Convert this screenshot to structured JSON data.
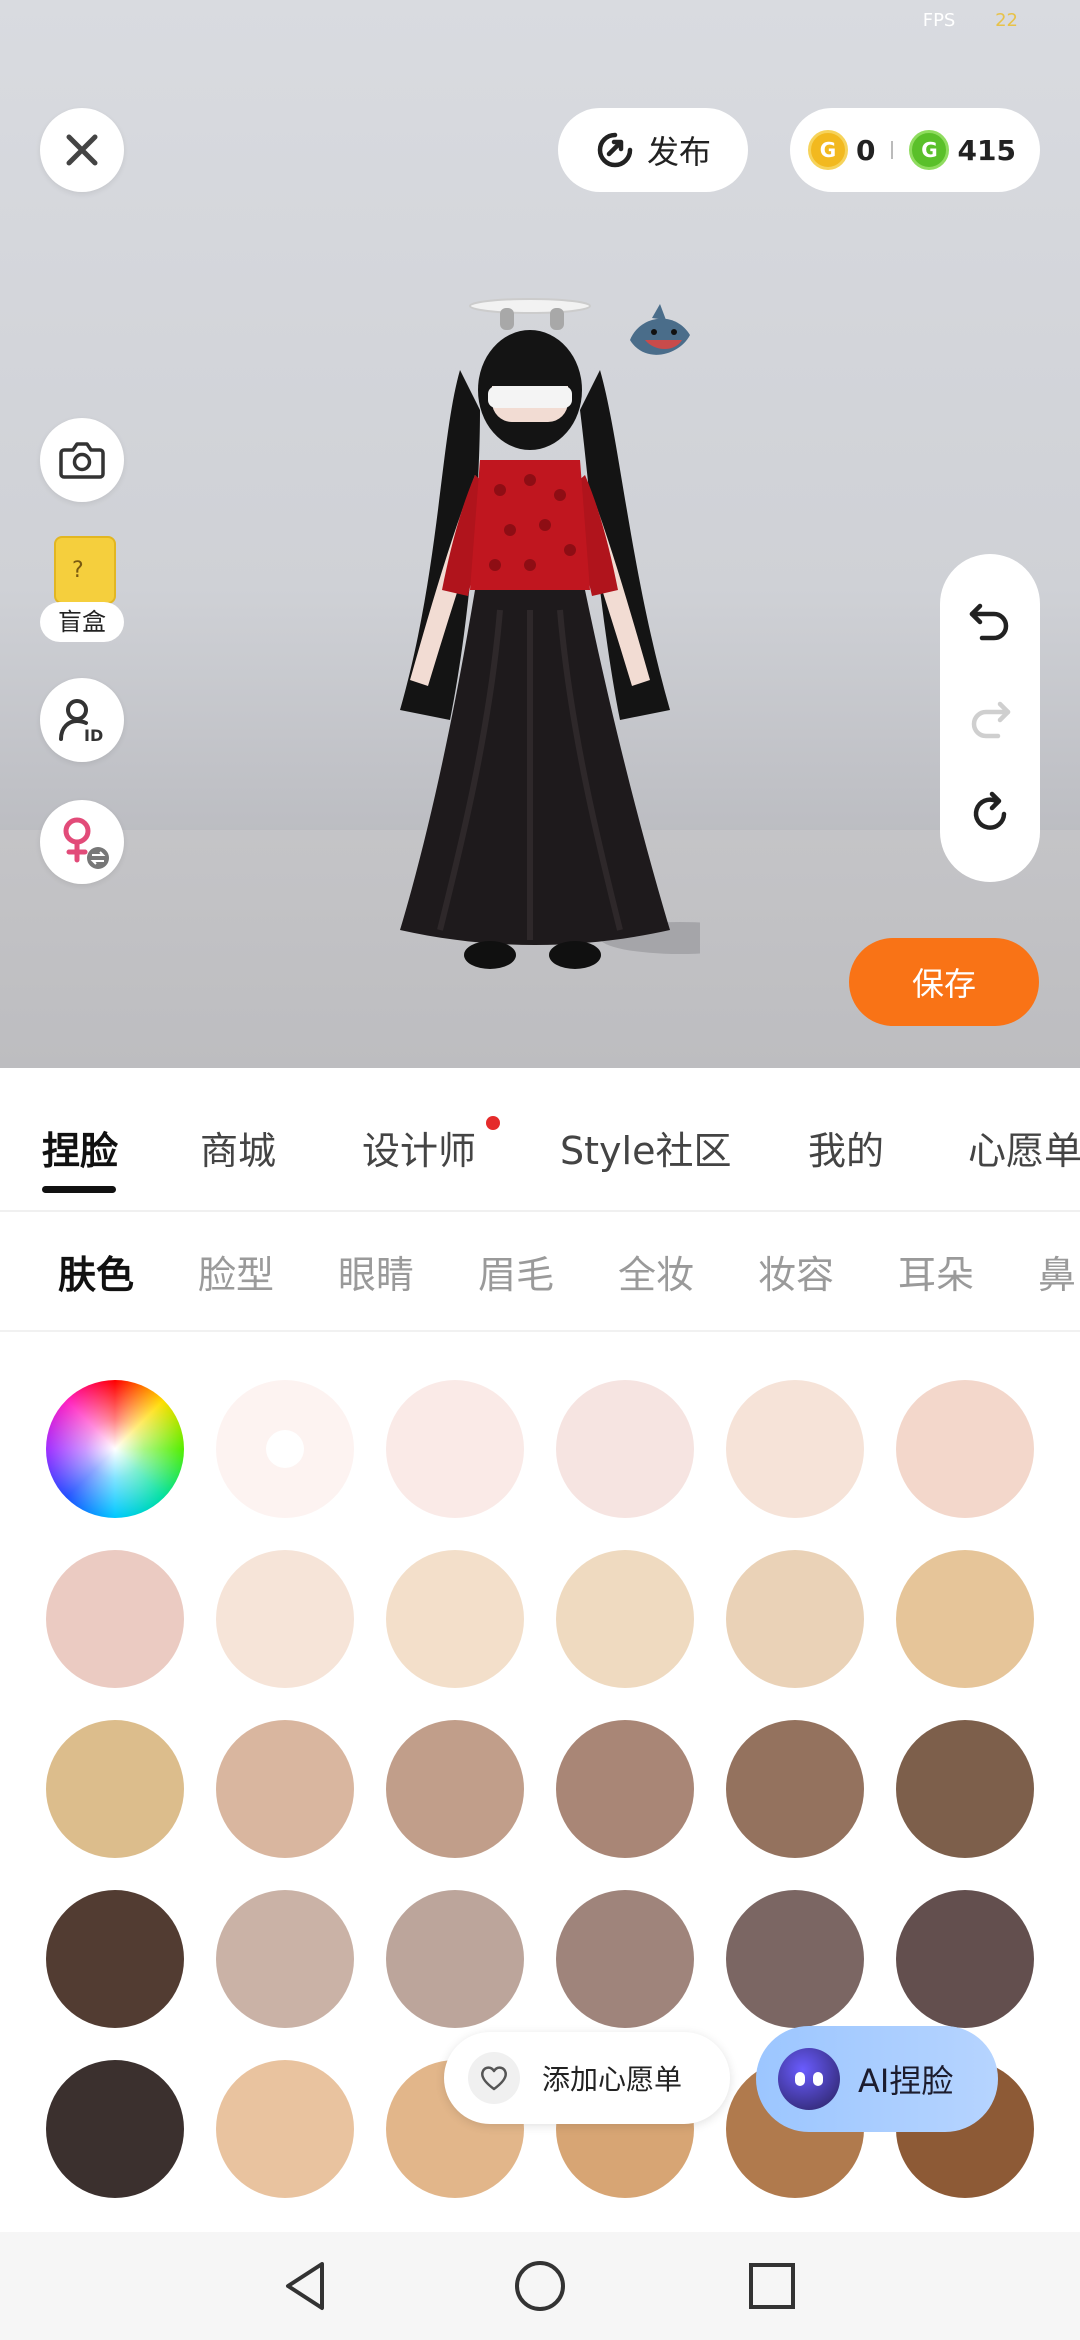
{
  "status": {
    "fps_label": "FPS",
    "fps_value": "22"
  },
  "topbar": {
    "publish_label": "发布",
    "gold_coins": "0",
    "green_coins": "415"
  },
  "left_tools": {
    "blindbox_label": "盲盒"
  },
  "save_label": "保存",
  "main_tabs": [
    {
      "label": "捏脸",
      "active": true
    },
    {
      "label": "商城"
    },
    {
      "label": "设计师",
      "has_dot": true
    },
    {
      "label": "Style社区"
    },
    {
      "label": "我的"
    },
    {
      "label": "心愿单"
    }
  ],
  "sub_tabs": [
    {
      "label": "肤色",
      "active": true
    },
    {
      "label": "脸型"
    },
    {
      "label": "眼睛"
    },
    {
      "label": "眉毛"
    },
    {
      "label": "全妆"
    },
    {
      "label": "妆容"
    },
    {
      "label": "耳朵"
    },
    {
      "label": "鼻"
    }
  ],
  "skin_colors": [
    "#fdf3f1",
    "#faeae7",
    "#f6e4e1",
    "#f6e3d8",
    "#f3d7cb",
    "#ebcbc2",
    "#f6e4d8",
    "#f3dfca",
    "#efdac0",
    "#ead2b7",
    "#e6c599",
    "#dcbd8c",
    "#d9b69f",
    "#c19e8a",
    "#a98676",
    "#94725e",
    "#7d5f4b",
    "#523c32",
    "#cab2a6",
    "#bca59b",
    "#9f847b",
    "#7b6663",
    "#634f4e",
    "#3b302e",
    "#e9c39f",
    "#e2b68a",
    "#d7a574",
    "#b07a4d",
    "#8d5a36"
  ],
  "wishlist_label": "添加心愿单",
  "ai_face_label": "AI捏脸",
  "colors": {
    "accent": "#f97316",
    "tab_dot": "#e52b2b"
  }
}
